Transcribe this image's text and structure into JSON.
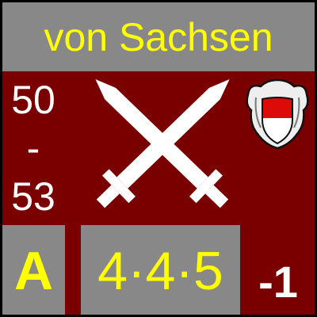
{
  "counter": {
    "title": "von Sachsen",
    "years": {
      "start": "50",
      "separator": "-",
      "end": "53"
    },
    "unit_letter": "A",
    "factors": "4·4·5",
    "modifier": "-1",
    "symbol": "crossed-swords-icon",
    "crest": "saxony-coat-of-arms-icon",
    "colors": {
      "background": "#7a0000",
      "panel": "#888888",
      "title_text": "#ffff00",
      "year_text": "#ffffff",
      "modifier_text": "#ffffff",
      "crest_field_red": "#dd0a0a"
    }
  }
}
